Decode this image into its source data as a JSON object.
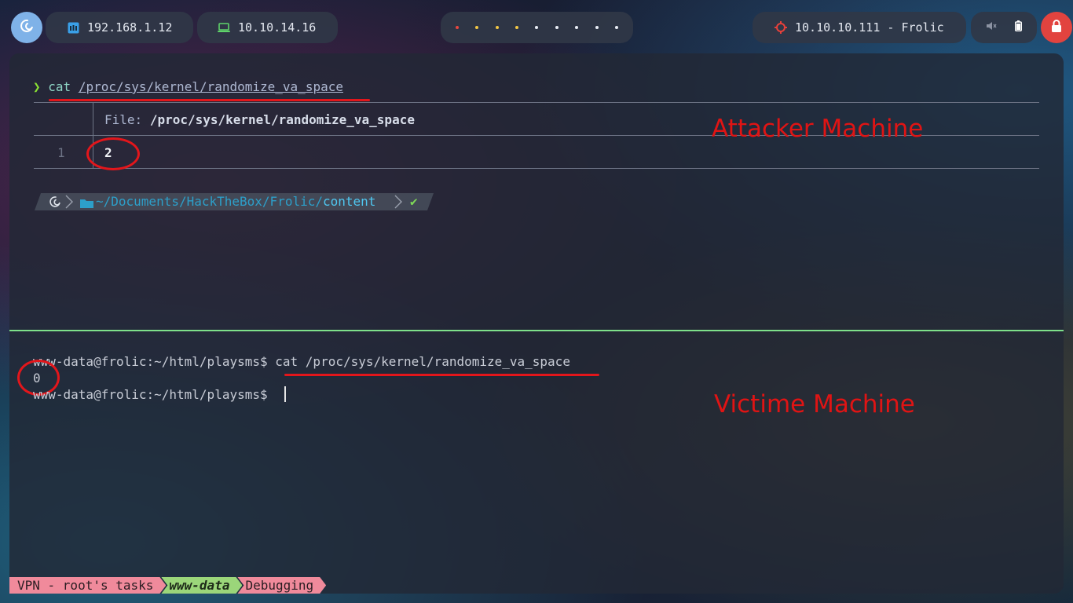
{
  "topbar": {
    "ip_local": "192.168.1.12",
    "ip_vpn": "10.10.14.16",
    "workspace_dots": [
      "#e8473f",
      "#f2c744",
      "#f2c744",
      "#f2c744",
      "#e8ecf4",
      "#e8ecf4",
      "#e8ecf4",
      "#e8ecf4",
      "#e8ecf4"
    ],
    "target": "10.10.10.111 - Frolic",
    "icons": {
      "launcher": "debian-swirl-icon",
      "local": "ethernet-icon",
      "vpn": "laptop-icon",
      "target": "crosshair-icon",
      "volume": "volume-muted-icon",
      "battery": "battery-icon",
      "lock": "lock-icon"
    }
  },
  "attacker_pane": {
    "prompt_symbol": "❯",
    "command": "cat",
    "argument": "/proc/sys/kernel/randomize_va_space",
    "bat_file_label": "File:",
    "bat_file_path": "/proc/sys/kernel/randomize_va_space",
    "line_number": "1",
    "file_content": "2",
    "cwd_prefix": "~/Documents/HackTheBox/Frolic/",
    "cwd_current": "content",
    "status_ok": "✔",
    "annotation": "Attacker Machine"
  },
  "victim_pane": {
    "prompt": "www-data@frolic:~/html/playsms$",
    "command": "cat /proc/sys/kernel/randomize_va_space",
    "output": "0",
    "prompt2": "www-data@frolic:~/html/playsms$",
    "annotation": "Victime Machine"
  },
  "tmux_status": {
    "segment1": "VPN - root's tasks",
    "segment2": "www-data",
    "segment3": "Debugging"
  },
  "colors": {
    "annotation_red": "#e01414",
    "divider_green": "#7ee08a",
    "lock_red": "#e2433f"
  }
}
